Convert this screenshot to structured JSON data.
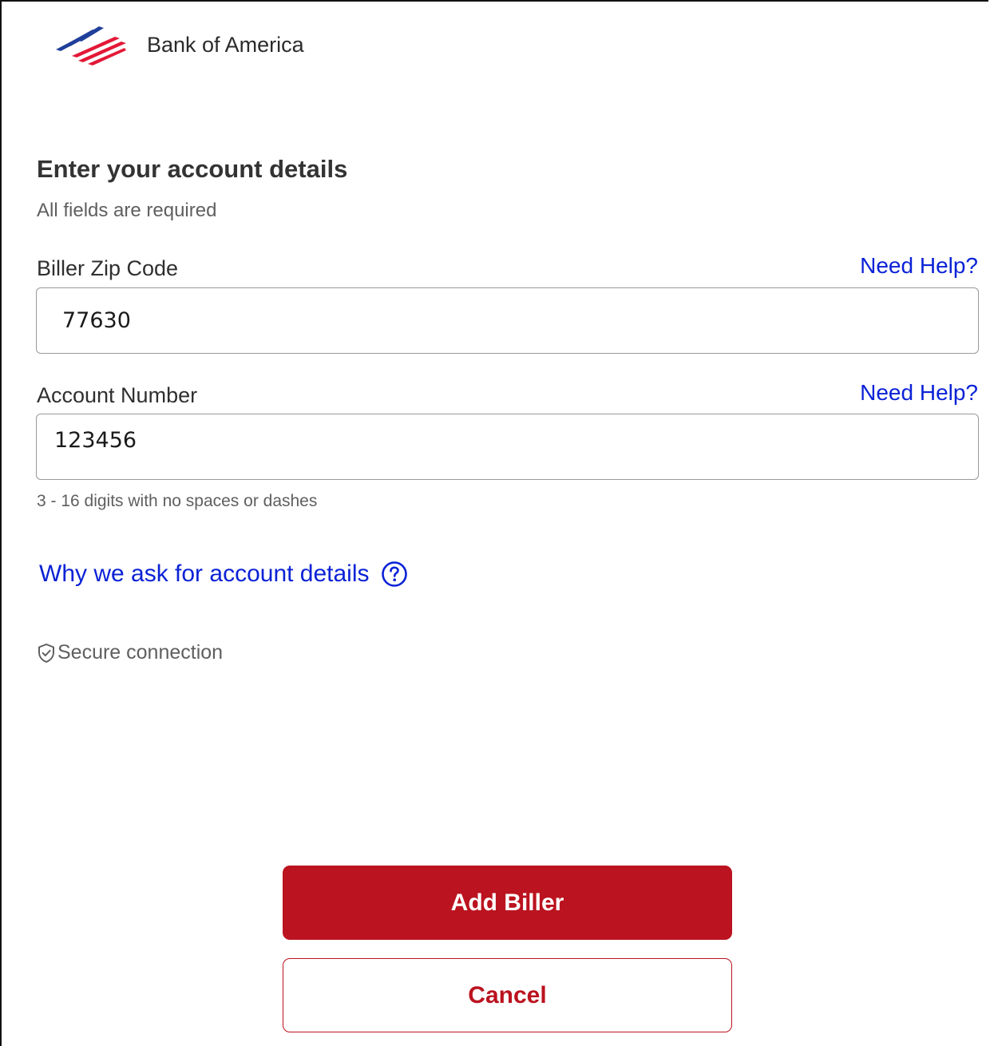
{
  "header": {
    "brand": "Bank of America",
    "logo_icon": "bank-of-america-flag-logo",
    "brand_red": "#e31837",
    "brand_blue": "#012169"
  },
  "form": {
    "title": "Enter your account details",
    "subtitle": "All fields are required",
    "zip": {
      "label": "Biller Zip Code",
      "help": "Need Help?",
      "value": "77630"
    },
    "account": {
      "label": "Account Number",
      "help": "Need Help?",
      "value": "123456",
      "hint": "3 - 16 digits with no spaces or dashes"
    },
    "why_link": "Why we ask for account details",
    "why_icon": "question-circle-icon",
    "secure": "Secure connection",
    "secure_icon": "shield-check-icon"
  },
  "actions": {
    "primary": "Add Biller",
    "secondary": "Cancel"
  },
  "colors": {
    "link": "#0a22d6",
    "primary_button": "#bb131f",
    "text_dark": "#333333",
    "text_muted": "#5f5f5f"
  }
}
